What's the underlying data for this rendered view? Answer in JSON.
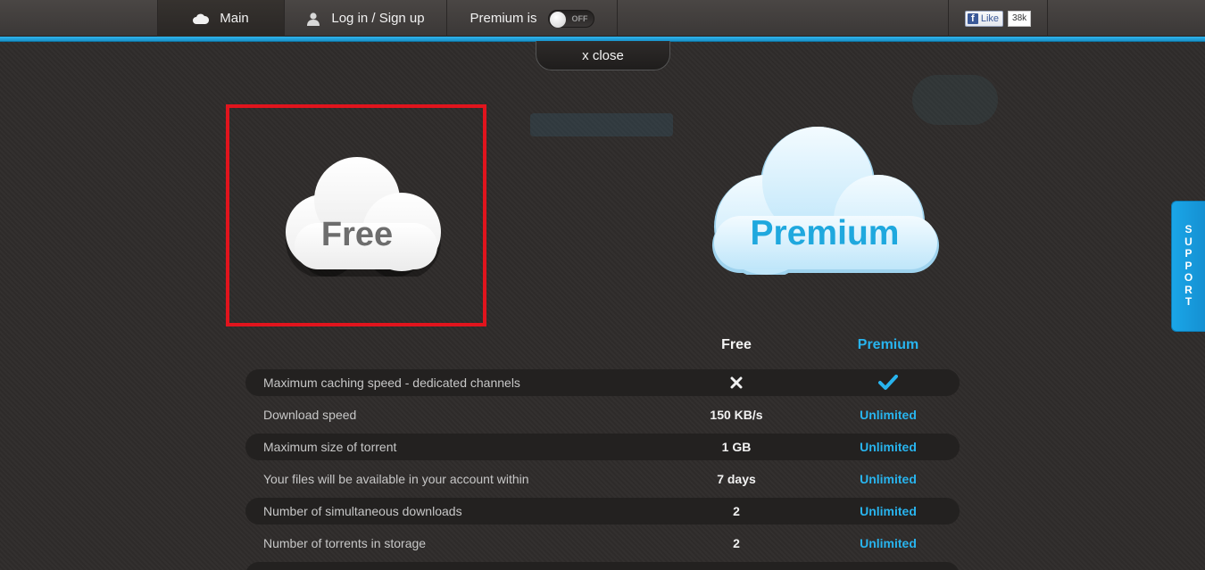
{
  "nav": {
    "main_label": "Main",
    "login_label": "Log in / Sign up",
    "premium_label": "Premium is",
    "premium_toggle_state": "OFF",
    "fb_like_label": "Like",
    "fb_like_count": "38k"
  },
  "close_label": "x close",
  "clouds": {
    "free_label": "Free",
    "premium_label": "Premium"
  },
  "table": {
    "headers": {
      "free": "Free",
      "premium": "Premium"
    },
    "rows": [
      {
        "label": "Maximum caching speed - dedicated channels",
        "free": "",
        "free_icon": "cross-icon",
        "premium": "",
        "premium_icon": "check-icon"
      },
      {
        "label": "Download speed",
        "free": "150 KB/s",
        "premium": "Unlimited"
      },
      {
        "label": "Maximum size of torrent",
        "free": "1 GB",
        "premium": "Unlimited"
      },
      {
        "label": "Your files will be available in your account within",
        "free": "7 days",
        "premium": "Unlimited"
      },
      {
        "label": "Number of simultaneous downloads",
        "free": "2",
        "premium": "Unlimited"
      },
      {
        "label": "Number of torrents in storage",
        "free": "2",
        "premium": "Unlimited"
      }
    ]
  },
  "support_label": "SUPPORT",
  "colors": {
    "accent": "#28b4ee",
    "highlight": "#e1141d",
    "background": "#2f2c2b"
  }
}
